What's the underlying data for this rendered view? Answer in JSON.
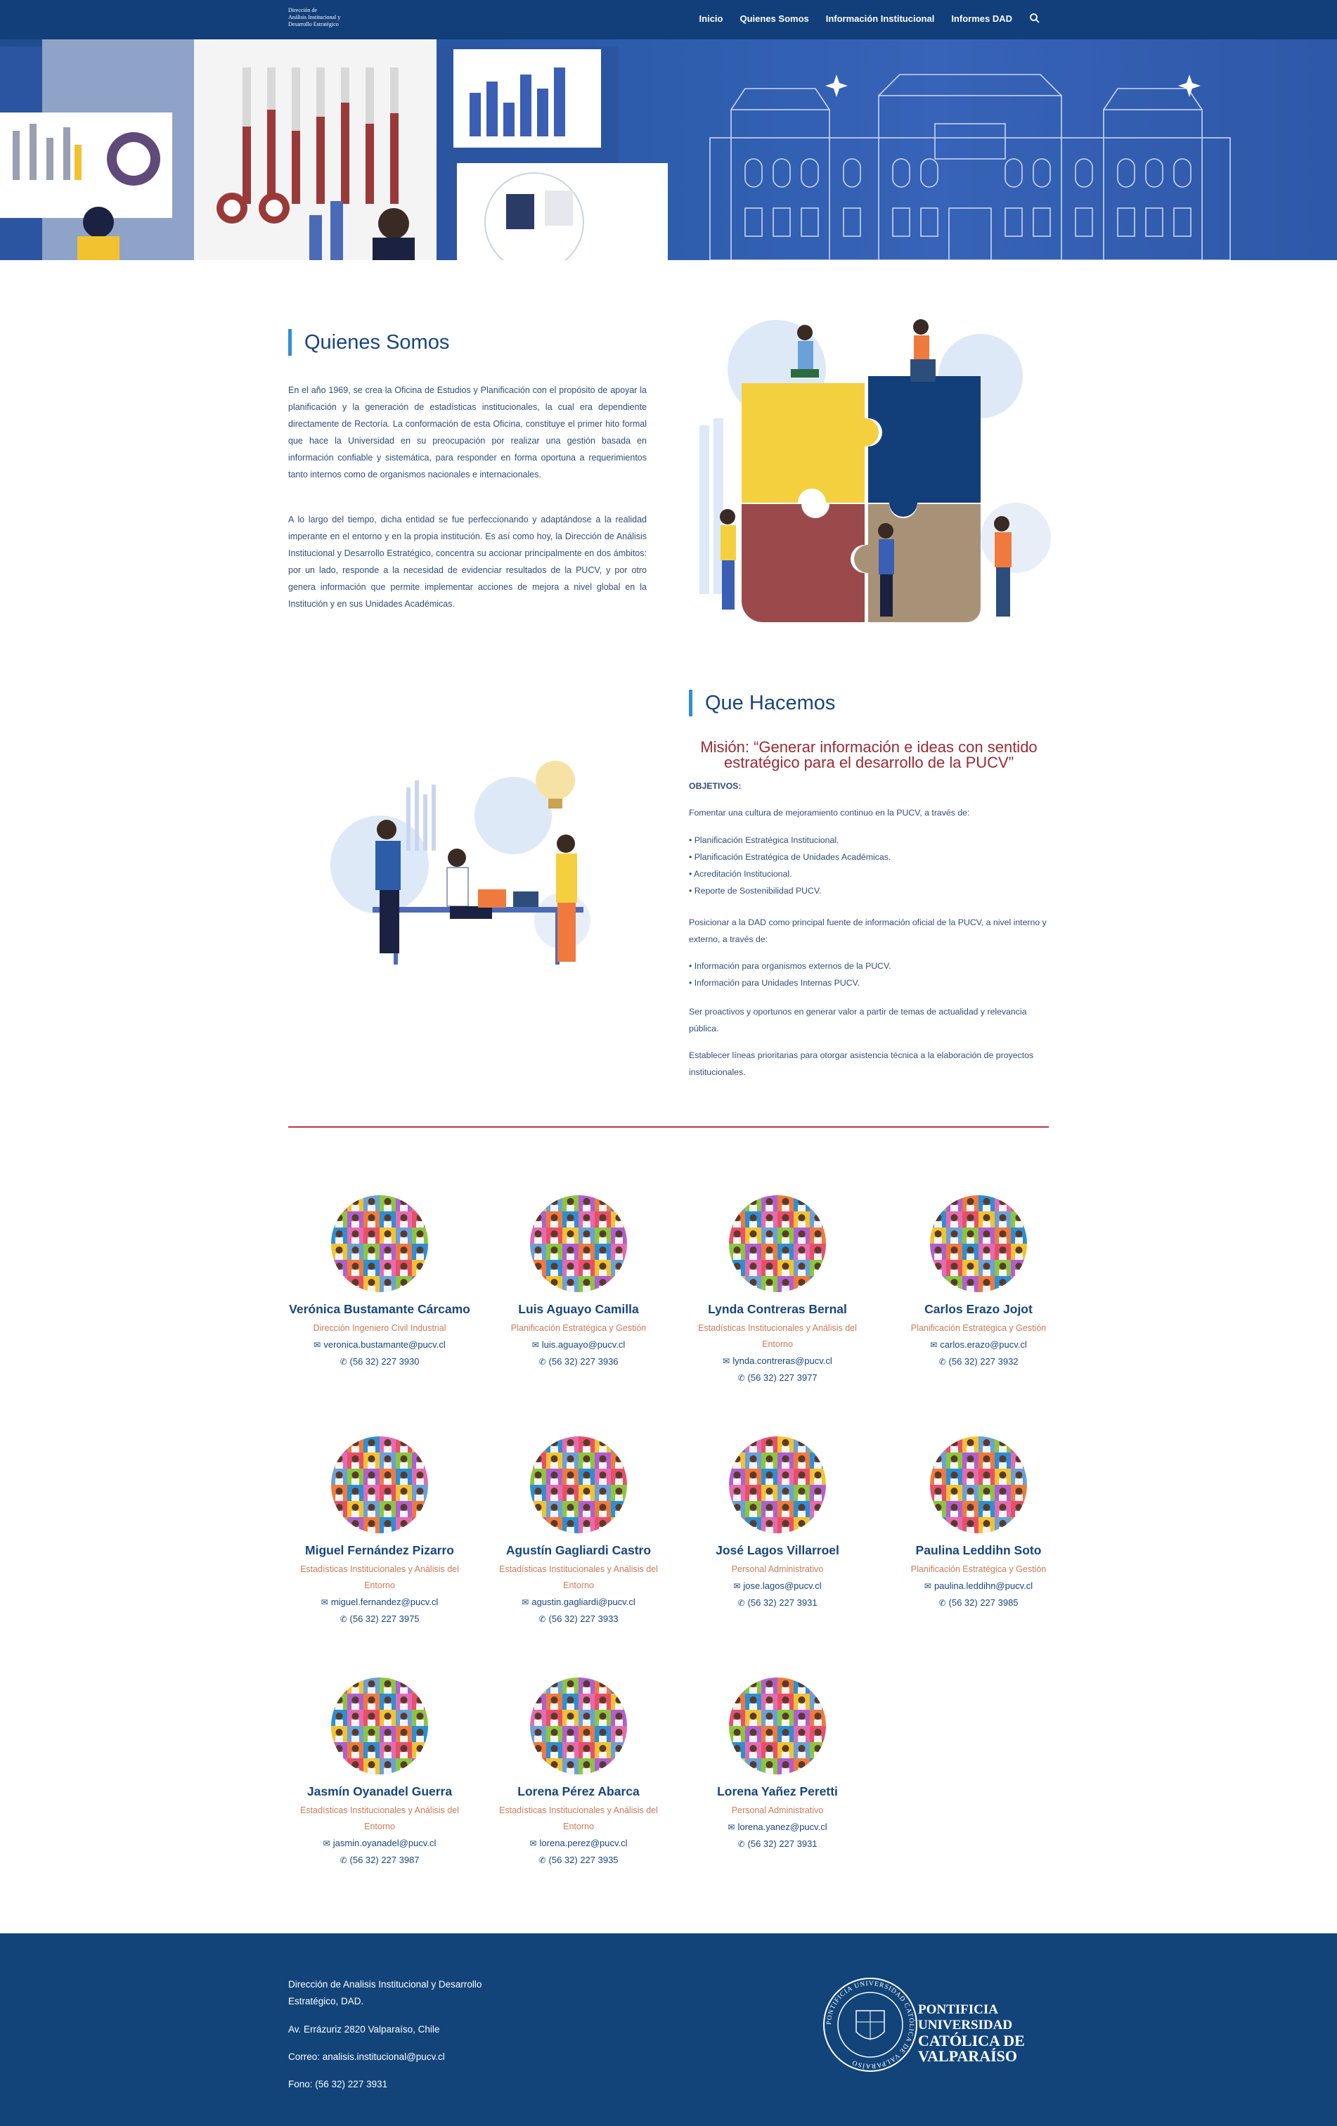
{
  "header": {
    "logo_lines": [
      "Dirección de",
      "Análisis Institucional y",
      "Desarrollo Estratégico"
    ],
    "nav": [
      "Inicio",
      "Quienes Somos",
      "Información Institucional",
      "Informes DAD"
    ]
  },
  "quienes": {
    "title": "Quienes Somos",
    "p1": "En el año 1969, se crea la Oficina de Estudios y Planificación con el propósito de apoyar la planificación y la generación de estadísticas institucionales, la cual era dependiente directamente de Rectoría. La conformación de esta Oficina, constituye el primer hito formal que hace la Universidad en su preocupación por realizar una gestión basada en información confiable y sistemática, para responder en forma oportuna a requerimientos tanto internos como de organismos nacionales e internacionales.",
    "p2": "A lo largo del tiempo, dicha entidad se fue perfeccionando y adaptándose a la realidad imperante en el entorno y en la propia institución. Es así como hoy, la Dirección de Análisis Institucional y Desarrollo Estratégico, concentra su accionar principalmente en dos ámbitos: por un lado, responde a la necesidad de evidenciar resultados de la PUCV, y por otro genera información que permite implementar acciones de mejora a nivel global en la Institución y en sus Unidades Académicas."
  },
  "hacemos": {
    "title": "Que Hacemos",
    "mision_line1": "Misión: “Generar información e ideas con sentido",
    "mision_line2": "estratégico para el desarrollo de la PUCV”",
    "objetivos_label": "OBJETIVOS:",
    "intro1": "Fomentar una cultura de mejoramiento continuo en la PUCV, a través de:",
    "list1": [
      "Planificación Estratégica Institucional.",
      "Planificación Estratégica de Unidades Académicas.",
      "Acreditación Institucional.",
      "Reporte de Sostenibilidad PUCV."
    ],
    "intro2": "Posicionar a la DAD como principal fuente de información oficial de la PUCV, a nivel interno y externo, a través de:",
    "list2": [
      "Información para organismos externos de la PUCV.",
      "Información para Unidades Internas PUCV."
    ],
    "p3": "Ser proactivos y oportunos en generar valor a partir de temas de actualidad y relevancia pública.",
    "p4": "Establecer líneas prioritarias para otorgar asistencia técnica a la elaboración de proyectos institucionales."
  },
  "team": [
    {
      "name": "Verónica Bustamante Cárcamo",
      "role": "Dirección Ingeniero Civil Industrial",
      "email": "veronica.bustamante@pucv.cl",
      "phone": "(56 32) 227 3930"
    },
    {
      "name": "Luis Aguayo Camilla",
      "role": "Planificación Estratégica y Gestión",
      "email": "luis.aguayo@pucv.cl",
      "phone": "(56 32) 227 3936"
    },
    {
      "name": "Lynda Contreras Bernal",
      "role": "Estadísticas Institucionales y Análisis del Entorno",
      "email": "lynda.contreras@pucv.cl",
      "phone": "(56 32) 227 3977"
    },
    {
      "name": "Carlos Erazo Jojot",
      "role": "Planificación Estratégica y Gestión",
      "email": "carlos.erazo@pucv.cl",
      "phone": "(56 32) 227 3932"
    },
    {
      "name": "Miguel Fernández Pizarro",
      "role": "Estadísticas Institucionales y Análisis del Entorno",
      "email": "miguel.fernandez@pucv.cl",
      "phone": "(56 32) 227 3975"
    },
    {
      "name": "Agustín Gagliardi Castro",
      "role": "Estadísticas Institucionales y Análisis del Entorno",
      "email": "agustin.gagliardi@pucv.cl",
      "phone": "(56 32) 227 3933"
    },
    {
      "name": "José Lagos Villarroel",
      "role": "Personal Administrativo",
      "email": "jose.lagos@pucv.cl",
      "phone": "(56 32) 227 3931"
    },
    {
      "name": "Paulina Leddihn Soto",
      "role": "Planificación Estratégica y Gestión",
      "email": "paulina.leddihn@pucv.cl",
      "phone": "(56 32) 227 3985"
    },
    {
      "name": "Jasmín Oyanadel Guerra",
      "role": "Estadísticas Institucionales y Análisis del Entorno",
      "email": "jasmin.oyanadel@pucv.cl",
      "phone": "(56 32) 227 3987"
    },
    {
      "name": "Lorena Pérez Abarca",
      "role": "Estadísticas Institucionales y Análisis del Entorno",
      "email": "lorena.perez@pucv.cl",
      "phone": "(56 32) 227 3935"
    },
    {
      "name": "Lorena Yañez Peretti",
      "role": "Personal Administrativo",
      "email": "lorena.yanez@pucv.cl",
      "phone": "(56 32) 227 3931"
    }
  ],
  "footer": {
    "line1": "Dirección de Analisis Institucional y Desarrollo",
    "line2": "Estratégico, DAD.",
    "address": "Av. Errázuriz 2820 Valparaíso, Chile",
    "email": "Correo: analisis.institucional@pucv.cl",
    "phone": "Fono: (56 32) 227 3931",
    "pucv_lines": [
      "PONTIFICIA",
      "UNIVERSIDAD",
      "CATÓLICA DE",
      "VALPARAÍSO"
    ],
    "seal_text": "PONTIFICIA UNIVERSIDAD CATÓLICA DE VALPARAÍSO"
  },
  "icons": {
    "search": "search-icon",
    "email": "email-icon",
    "phone": "phone-icon"
  },
  "colors": {
    "navy": "#123f7a",
    "accent_blue": "#2d8fd5",
    "mision_red": "#9b2a33",
    "role_orange": "#cc7a59",
    "divider": "#b8354a",
    "footer": "#124479"
  }
}
